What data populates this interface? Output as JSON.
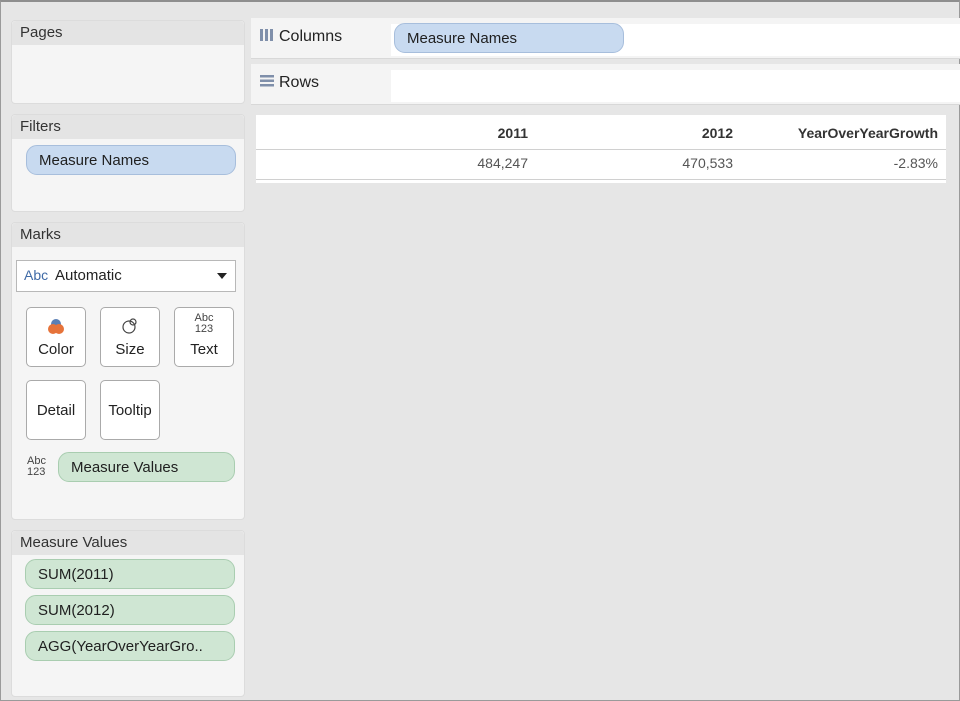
{
  "pages": {
    "title": "Pages"
  },
  "filters": {
    "title": "Filters",
    "pill": "Measure Names"
  },
  "marks": {
    "title": "Marks",
    "mark_type_icon": "Abc",
    "mark_type": "Automatic",
    "buttons": {
      "color": "Color",
      "size": "Size",
      "text": "Text",
      "detail": "Detail",
      "tooltip": "Tooltip"
    },
    "text_icon_top": "Abc",
    "text_icon_bottom": "123",
    "measure_values_pill": "Measure Values"
  },
  "measure_values": {
    "title": "Measure Values",
    "items": [
      "SUM(2011)",
      "SUM(2012)",
      "AGG(YearOverYearGro.."
    ]
  },
  "shelves": {
    "columns_label": "Columns",
    "columns_pill": "Measure Names",
    "rows_label": "Rows"
  },
  "table": {
    "headers": [
      "2011",
      "2012",
      "YearOverYearGrowth"
    ],
    "values": [
      "484,247",
      "470,533",
      "-2.83%"
    ]
  },
  "colors": {
    "dimension_pill": "#c8daf0",
    "measure_pill": "#cfe6d3",
    "color_icon_orange": "#e6733a",
    "color_icon_blue": "#5a7fb5"
  }
}
